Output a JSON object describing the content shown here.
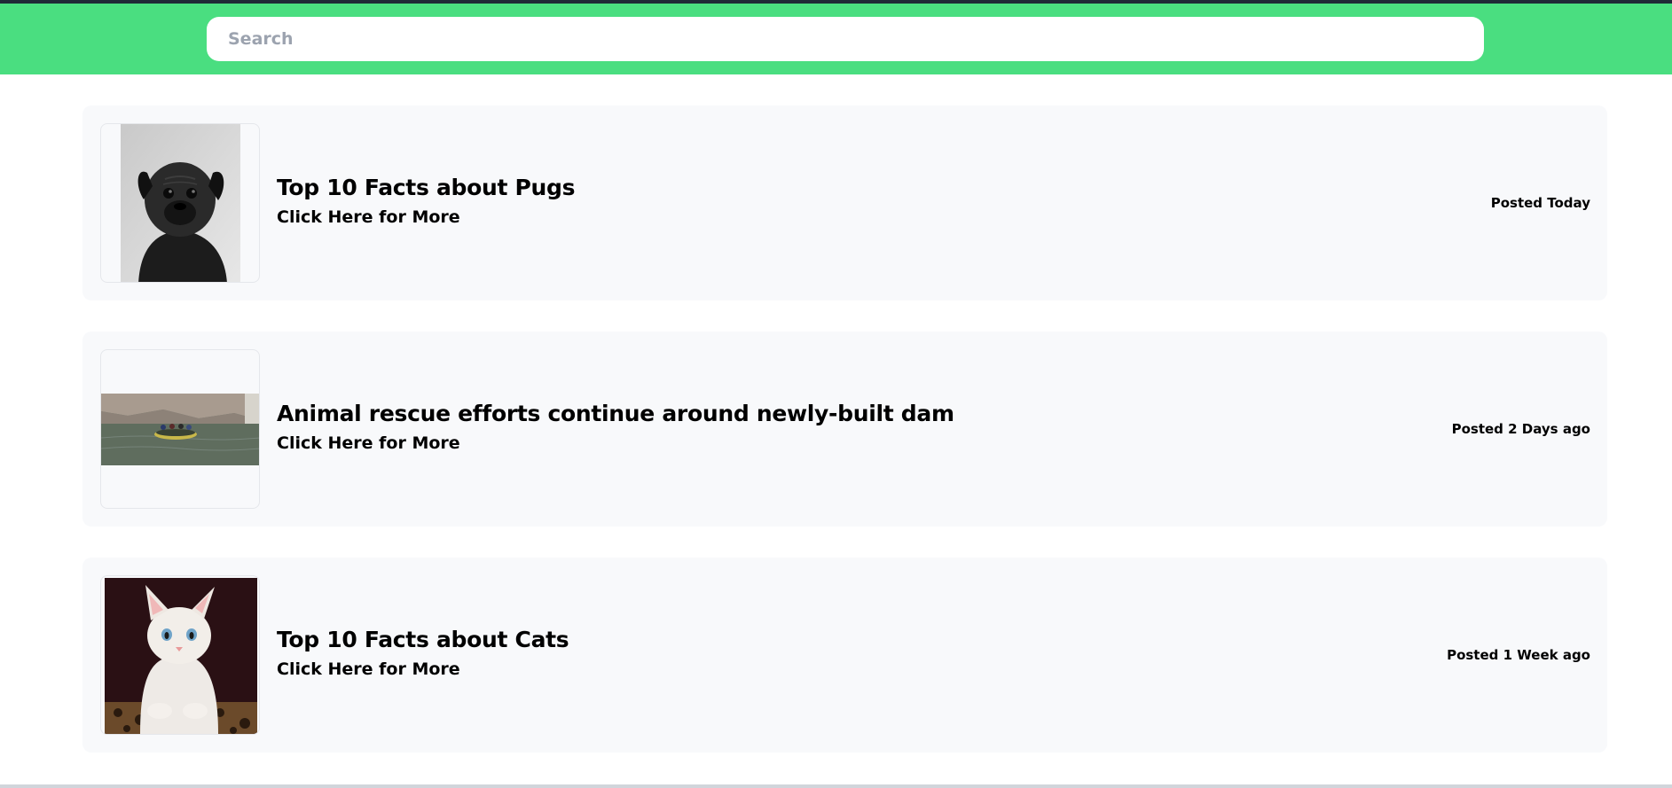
{
  "search": {
    "placeholder": "Search",
    "value": ""
  },
  "posts": [
    {
      "title": "Top 10 Facts about Pugs",
      "link_text": "Click Here for More",
      "posted": "Posted Today",
      "image": "pug-photo"
    },
    {
      "title": "Animal rescue efforts continue around newly-built dam",
      "link_text": "Click Here for More",
      "posted": "Posted 2 Days ago",
      "image": "rescue-raft-photo"
    },
    {
      "title": "Top 10 Facts about Cats",
      "link_text": "Click Here for More",
      "posted": "Posted 1 Week ago",
      "image": "kitten-photo"
    }
  ],
  "colors": {
    "header": "#4ade80",
    "card": "#f8f9fb",
    "text": "#000000",
    "placeholder": "#9ca3af"
  }
}
